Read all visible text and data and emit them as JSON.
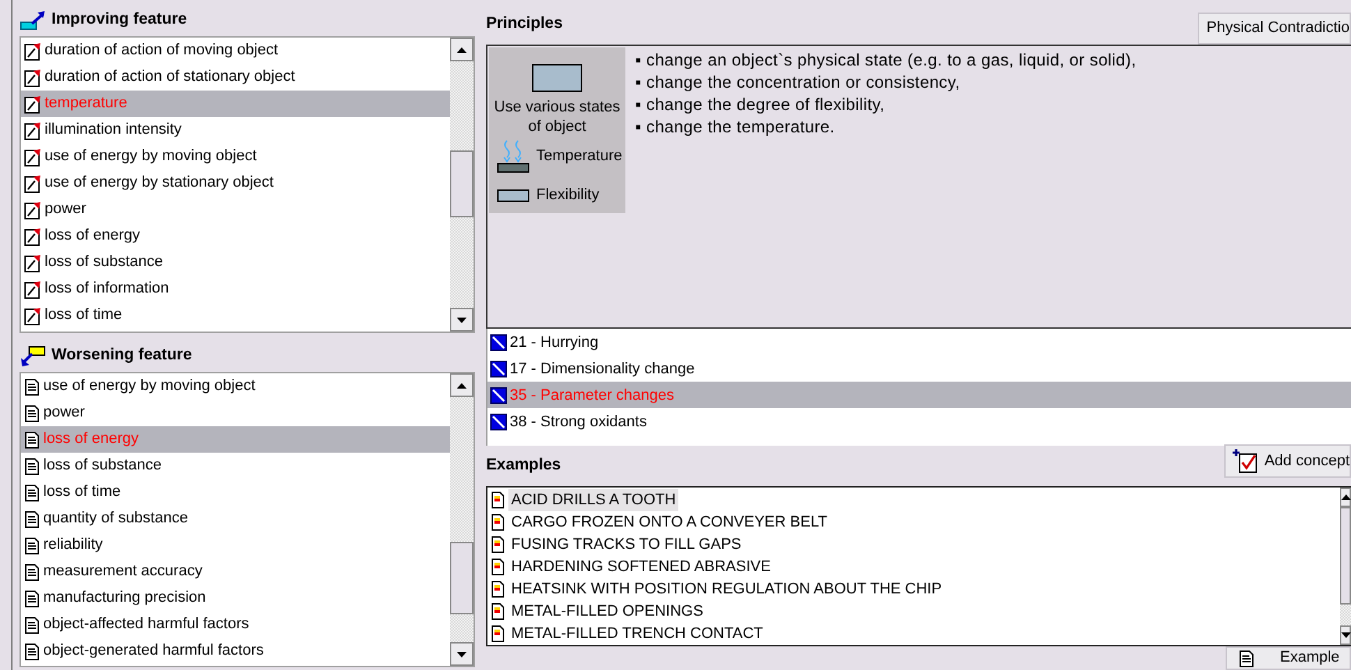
{
  "improving_feature": {
    "title": "Improving feature",
    "items": [
      {
        "label": "duration of action of moving object",
        "selected": false
      },
      {
        "label": "duration of action of stationary object",
        "selected": false
      },
      {
        "label": "temperature",
        "selected": true
      },
      {
        "label": "illumination intensity",
        "selected": false
      },
      {
        "label": "use of energy by moving object",
        "selected": false
      },
      {
        "label": "use of energy by stationary object",
        "selected": false
      },
      {
        "label": "power",
        "selected": false
      },
      {
        "label": "loss of energy",
        "selected": false
      },
      {
        "label": "loss of substance",
        "selected": false
      },
      {
        "label": "loss of information",
        "selected": false
      },
      {
        "label": "loss of time",
        "selected": false
      }
    ]
  },
  "worsening_feature": {
    "title": "Worsening feature",
    "items": [
      {
        "label": "use of energy by moving object",
        "selected": false
      },
      {
        "label": "power",
        "selected": false
      },
      {
        "label": "loss of energy",
        "selected": true
      },
      {
        "label": "loss of substance",
        "selected": false
      },
      {
        "label": "loss of time",
        "selected": false
      },
      {
        "label": "quantity of substance",
        "selected": false
      },
      {
        "label": "reliability",
        "selected": false
      },
      {
        "label": "measurement accuracy",
        "selected": false
      },
      {
        "label": "manufacturing precision",
        "selected": false
      },
      {
        "label": "object-affected harmful factors",
        "selected": false
      },
      {
        "label": "object-generated harmful factors",
        "selected": false
      }
    ]
  },
  "principles": {
    "title": "Principles",
    "contradiction_button": "Physical Contradictio",
    "card": {
      "caption": "Use various states of object",
      "legend": [
        {
          "label": "Temperature",
          "kind": "heat"
        },
        {
          "label": "Flexibility",
          "kind": "flex"
        }
      ]
    },
    "bullets": [
      "▪ change an object`s physical state (e.g. to a gas, liquid, or solid),",
      "▪ change the concentration or consistency,",
      "▪ change the degree of flexibility,",
      "▪ change the temperature."
    ],
    "items": [
      {
        "label": "21 - Hurrying",
        "selected": false
      },
      {
        "label": "17 - Dimensionality change",
        "selected": false
      },
      {
        "label": "35 - Parameter changes",
        "selected": true
      },
      {
        "label": "38 - Strong oxidants",
        "selected": false
      }
    ]
  },
  "examples": {
    "title": "Examples",
    "add_button": "Add concept",
    "example_button": "Example",
    "items": [
      {
        "label": "ACID DRILLS A TOOTH",
        "selected": true
      },
      {
        "label": "CARGO FROZEN ONTO A CONVEYER BELT",
        "selected": false
      },
      {
        "label": "FUSING TRACKS TO FILL GAPS",
        "selected": false
      },
      {
        "label": "HARDENING SOFTENED ABRASIVE",
        "selected": false
      },
      {
        "label": "HEATSINK WITH POSITION REGULATION ABOUT THE CHIP",
        "selected": false
      },
      {
        "label": "METAL-FILLED OPENINGS",
        "selected": false
      },
      {
        "label": "METAL-FILLED TRENCH CONTACT",
        "selected": false
      }
    ]
  }
}
